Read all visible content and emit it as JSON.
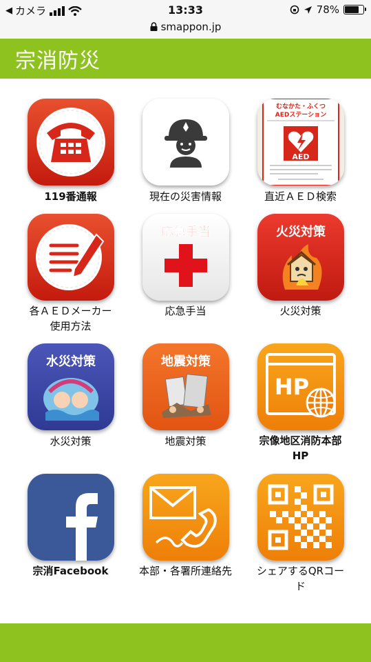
{
  "status_bar": {
    "carrier": "カメラ",
    "time": "13:33",
    "battery": "78%",
    "battery_level": 0.78
  },
  "url_bar": {
    "url": "smappon.jp"
  },
  "header": {
    "title": "宗消防災"
  },
  "tiles": [
    {
      "label": "119番通報",
      "icon": "phone-icon"
    },
    {
      "label": "現在の災害情報",
      "icon": "firefighter-icon"
    },
    {
      "label": "直近ＡＥＤ検索",
      "icon": "aed-station-icon",
      "icon_text": [
        "むなかた・ふくつ",
        "AEDステーション",
        "AED"
      ]
    },
    {
      "label": "各ＡＥＤメーカー使用方法",
      "icon": "manual-icon"
    },
    {
      "label": "応急手当",
      "icon": "first-aid-icon",
      "icon_text": "応急手当"
    },
    {
      "label": "火災対策",
      "icon": "fire-icon",
      "icon_text": "火災対策"
    },
    {
      "label": "水災対策",
      "icon": "flood-icon",
      "icon_text": "水災対策"
    },
    {
      "label": "地震対策",
      "icon": "earthquake-icon",
      "icon_text": "地震対策"
    },
    {
      "label": "宗像地区消防本部HP",
      "icon": "homepage-icon",
      "icon_text": "HP"
    },
    {
      "label": "宗消Facebook",
      "icon": "facebook-icon",
      "icon_text": "f"
    },
    {
      "label": "本部・各署所連絡先",
      "icon": "contact-icon"
    },
    {
      "label": "シェアするQRコード",
      "icon": "qr-code-icon"
    }
  ],
  "colors": {
    "accent": "#8dc21f",
    "red": "#d7261a",
    "orange": "#f18a0c",
    "blue": "#3b5998"
  }
}
